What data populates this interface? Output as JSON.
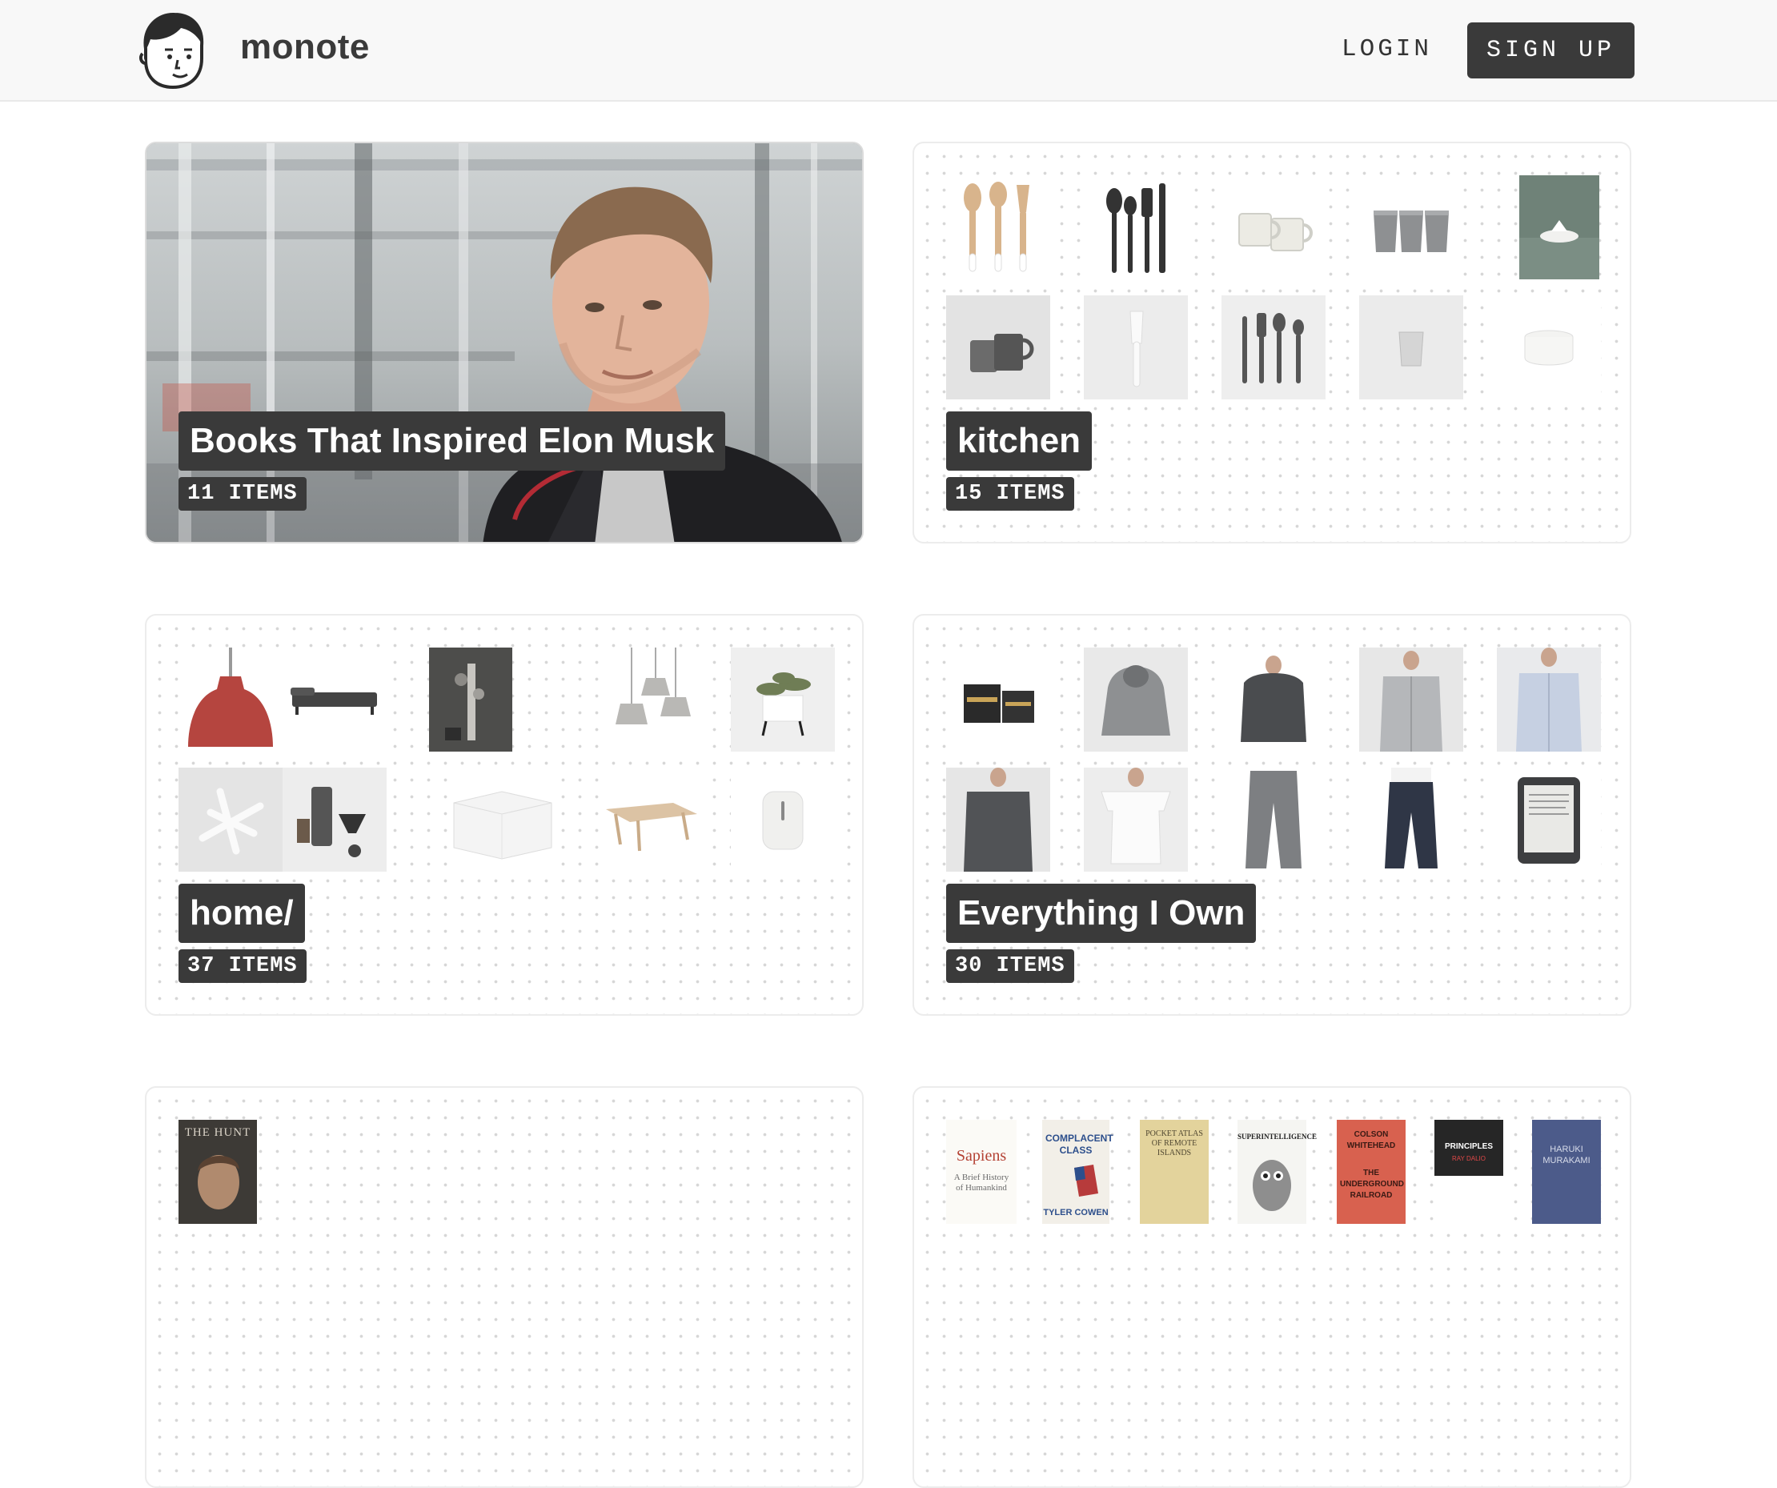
{
  "header": {
    "brand": "monote",
    "login_label": "LOGIN",
    "signup_label": "SIGN UP"
  },
  "collections": [
    {
      "title": "Books That Inspired Elon Musk",
      "count": "11 ITEMS",
      "cover": "photo"
    },
    {
      "title": "kitchen",
      "count": "15 ITEMS"
    },
    {
      "title": "home/",
      "count": "37 ITEMS"
    },
    {
      "title": "Everything I Own",
      "count": "30 ITEMS"
    },
    {
      "title": "",
      "count": ""
    },
    {
      "title": "",
      "count": ""
    }
  ],
  "book_covers": [
    {
      "title": "THE HUNT"
    },
    {
      "title": "Sapiens",
      "subtitle": "A Brief History of Humankind"
    },
    {
      "title": "COMPLACENT CLASS",
      "author": "TYLER COWEN"
    },
    {
      "title": "POCKET ATLAS OF REMOTE ISLANDS"
    },
    {
      "title": "SUPERINTELLIGENCE"
    },
    {
      "title": "COLSON WHITEHEAD",
      "subtitle": "THE UNDERGROUND RAILROAD"
    },
    {
      "title": "PRINCIPLES",
      "author": "RAY DALIO"
    },
    {
      "title": "HARUKI MURAKAMI"
    }
  ],
  "icons": {
    "logo": "face-avatar-icon"
  },
  "colors": {
    "dark": "#3a3a3a",
    "header_bg": "#f8f8f8",
    "dot": "#d6d6d6"
  }
}
